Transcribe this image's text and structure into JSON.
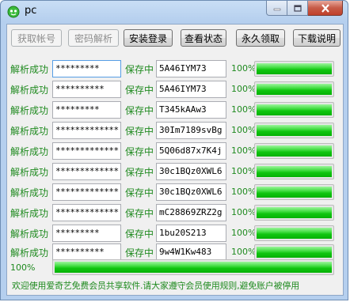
{
  "window": {
    "title": "pc"
  },
  "toolbar": {
    "buttons": [
      {
        "label": "获取帐号",
        "enabled": false
      },
      {
        "label": "密码解析",
        "enabled": false
      },
      {
        "label": "安装登录",
        "enabled": true
      },
      {
        "label": "查看状态",
        "enabled": true
      },
      {
        "label": "永久领取",
        "enabled": true
      },
      {
        "label": "下载说明",
        "enabled": true
      }
    ]
  },
  "rows": [
    {
      "status": "解析成功",
      "password": "*********",
      "save": "保存中",
      "code": "5A46IYM73",
      "percent": "100%",
      "progress": 1.0
    },
    {
      "status": "解析成功",
      "password": "**********",
      "save": "保存中",
      "code": "5A46IYM73",
      "percent": "100%",
      "progress": 1.0
    },
    {
      "status": "解析成功",
      "password": "*********",
      "save": "保存中",
      "code": "T345kAAw3",
      "percent": "100%",
      "progress": 1.0
    },
    {
      "status": "解析成功",
      "password": "*************",
      "save": "保存中",
      "code": "30Im7189svBg",
      "percent": "100%",
      "progress": 1.0
    },
    {
      "status": "解析成功",
      "password": "*************",
      "save": "保存中",
      "code": "5Q06d87x7K4j",
      "percent": "100%",
      "progress": 1.0
    },
    {
      "status": "解析成功",
      "password": "*************",
      "save": "保存中",
      "code": "30c1BQz0XWL6",
      "percent": "100%",
      "progress": 1.0
    },
    {
      "status": "解析成功",
      "password": "*************",
      "save": "保存中",
      "code": "30c1BQz0XWL6",
      "percent": "100%",
      "progress": 1.0
    },
    {
      "status": "解析成功",
      "password": "*************",
      "save": "保存中",
      "code": "mC28869ZRZ2g",
      "percent": "100%",
      "progress": 1.0
    },
    {
      "status": "解析成功",
      "password": "*********",
      "save": "保存中",
      "code": "1bu20S213",
      "percent": "100%",
      "progress": 1.0
    },
    {
      "status": "解析成功",
      "password": "**********",
      "save": "保存中",
      "code": "9w4W1Kw483",
      "percent": "100%",
      "progress": 1.0
    }
  ],
  "total": {
    "percent": "100%",
    "progress": 1.0
  },
  "notice": "欢迎使用爱奇艺免费会员共享软件.请大家遵守会员使用规则,避免账户被停用",
  "colors": {
    "status_text": "#1f8a1f",
    "progress_fill": "#0fc50f"
  }
}
